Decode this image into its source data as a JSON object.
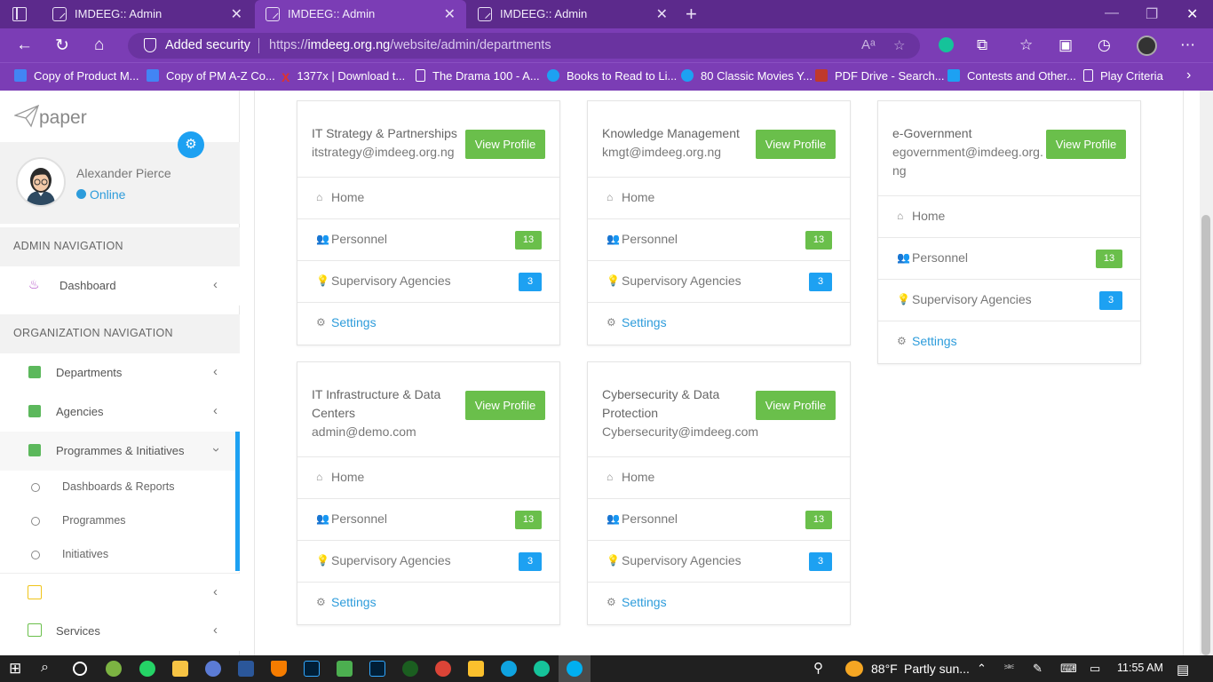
{
  "browser": {
    "tabs": [
      {
        "title": "IMDEEG:: Admin"
      },
      {
        "title": "IMDEEG:: Admin"
      },
      {
        "title": "IMDEEG:: Admin"
      }
    ],
    "security_label": "Added security",
    "url_prefix": "https://",
    "url_domain": "imdeeg.org.ng",
    "url_path": "/website/admin/departments",
    "bookmarks": [
      {
        "label": "Copy of Product M...",
        "color": "#4285f4"
      },
      {
        "label": "Copy of PM A-Z Co...",
        "color": "#4285f4"
      },
      {
        "label": "1377x | Download t...",
        "color": "#e0322b"
      },
      {
        "label": "The Drama 100 - A...",
        "color": "#ffffff"
      },
      {
        "label": "Books to Read to Li...",
        "color": "#1da1f2"
      },
      {
        "label": "80 Classic Movies Y...",
        "color": "#1da1f2"
      },
      {
        "label": "PDF Drive - Search...",
        "color": "#c0392b"
      },
      {
        "label": "Contests and Other...",
        "color": "#1da1f2"
      },
      {
        "label": "Play Criteria",
        "color": "#ffffff"
      }
    ]
  },
  "sidebar": {
    "logo": "paper",
    "user_name": "Alexander Pierce",
    "user_status": "Online",
    "admin_nav_title": "ADMIN NAVIGATION",
    "dashboard_label": "Dashboard",
    "org_nav_title": "ORGANIZATION NAVIGATION",
    "items": [
      {
        "label": "Departments"
      },
      {
        "label": "Agencies"
      },
      {
        "label": "Programmes & Initiatives"
      }
    ],
    "subitems": [
      {
        "label": "Dashboards & Reports"
      },
      {
        "label": "Programmes"
      },
      {
        "label": "Initiatives"
      }
    ],
    "services_label": "Services"
  },
  "cards": [
    {
      "name": "IT Strategy & Partnerships",
      "email": "itstrategy@imdeeg.org.ng",
      "view_label": "View Profile",
      "home": "Home",
      "personnel": "Personnel",
      "personnel_count": "13",
      "agencies": "Supervisory Agencies",
      "agencies_count": "3",
      "settings": "Settings"
    },
    {
      "name": "Knowledge Management",
      "email": "kmgt@imdeeg.org.ng",
      "view_label": "View Profile",
      "home": "Home",
      "personnel": "Personnel",
      "personnel_count": "13",
      "agencies": "Supervisory Agencies",
      "agencies_count": "3",
      "settings": "Settings"
    },
    {
      "name": "e-Government",
      "email": "egovernment@imdeeg.org.ng",
      "view_label": "View Profile",
      "home": "Home",
      "personnel": "Personnel",
      "personnel_count": "13",
      "agencies": "Supervisory Agencies",
      "agencies_count": "3",
      "settings": "Settings"
    },
    {
      "name": "IT Infrastructure & Data Centers",
      "email": "admin@demo.com",
      "view_label": "View Profile",
      "home": "Home",
      "personnel": "Personnel",
      "personnel_count": "13",
      "agencies": "Supervisory Agencies",
      "agencies_count": "3",
      "settings": "Settings"
    },
    {
      "name": "Cybersecurity & Data Protection",
      "email": "Cybersecurity@imdeeg.com",
      "view_label": "View Profile",
      "home": "Home",
      "personnel": "Personnel",
      "personnel_count": "13",
      "agencies": "Supervisory Agencies",
      "agencies_count": "3",
      "settings": "Settings"
    }
  ],
  "taskbar": {
    "temperature": "88°F",
    "weather": "Partly sun...",
    "time": "11:55 AM"
  }
}
